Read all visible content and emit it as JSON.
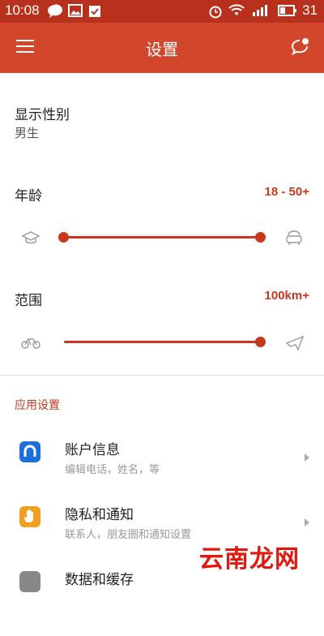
{
  "status_bar": {
    "time": "10:08",
    "battery": "31"
  },
  "app_bar": {
    "title": "设置"
  },
  "gender": {
    "label": "显示性别",
    "value": "男生"
  },
  "age": {
    "label": "年龄",
    "value": "18 - 50+",
    "range_min_fraction": 0.0,
    "range_max_fraction": 1.0
  },
  "distance": {
    "label": "范围",
    "value": "100km+",
    "slider_fraction": 1.0
  },
  "app_settings": {
    "title": "应用设置",
    "items": [
      {
        "title": "账户信息",
        "subtitle": "编辑电话，姓名，等",
        "icon": "account-icon",
        "color": "#1e6fd9"
      },
      {
        "title": "隐私和通知",
        "subtitle": "联系人，朋友圈和通知设置",
        "icon": "hand-icon",
        "color": "#f0a020"
      },
      {
        "title": "数据和缓存",
        "subtitle": "",
        "icon": "data-icon",
        "color": "#888888"
      }
    ]
  },
  "watermark": "云南龙网",
  "colors": {
    "accent": "#c8381f",
    "app_bar": "#d2472b",
    "status_bar": "#b8311c"
  }
}
